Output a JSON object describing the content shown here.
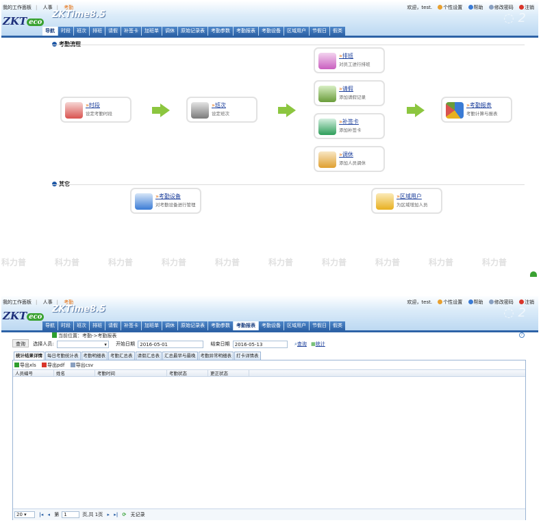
{
  "header": {
    "links": [
      "我的工作面板",
      "人事",
      "考勤"
    ],
    "user": [
      "欢迎，test.",
      "个性设置",
      "帮助",
      "修改密码",
      "注销"
    ],
    "logo_main": "ZKT",
    "logo_eco": "eco",
    "product": "ZKTime8.5"
  },
  "tabs": [
    "导航",
    "时段",
    "班次",
    "排班",
    "请假",
    "补签卡",
    "加班单",
    "调休",
    "原始记录表",
    "考勤参数",
    "考勤报表",
    "考勤设备",
    "区域用户",
    "节假日",
    "假类"
  ],
  "flow": {
    "section1": "考勤流程",
    "section2": "其它",
    "cards": [
      {
        "title": "时段",
        "desc": "设定考勤时段",
        "color": "#d9534f"
      },
      {
        "title": "班次",
        "desc": "设定班次",
        "color": "#7a7a7a"
      },
      {
        "title": "排班",
        "desc": "对员工进行排班",
        "color": "#c95fbf"
      },
      {
        "title": "请假",
        "desc": "添加请假记录",
        "color": "#6a9c3a"
      },
      {
        "title": "补签卡",
        "desc": "添加补签卡",
        "color": "#2e9e5a"
      },
      {
        "title": "调休",
        "desc": "添加人员调休",
        "color": "#e0a030"
      },
      {
        "title": "考勤报表",
        "desc": "考勤计算与报表",
        "color": "#3a7bd5"
      },
      {
        "title": "考勤设备",
        "desc": "对考勤设备进行管理",
        "color": "#3a7bd5"
      },
      {
        "title": "区域用户",
        "desc": "为区域增加人员",
        "color": "#e8b020"
      }
    ]
  },
  "watermark": "科力普",
  "report": {
    "breadcrumb": "当前位置：考勤->考勤报表",
    "query_button": "查询",
    "person_label": "选择人员:",
    "start_label": "开始日期",
    "start_date": "2016-05-01",
    "end_label": "结束日期",
    "end_date": "2016-05-13",
    "action_query": "查询",
    "action_stat": "统计",
    "subtabs": [
      "统计结果详情",
      "每日考勤统计表",
      "考勤明细表",
      "考勤汇总表",
      "请假汇总表",
      "汇总最早与最晚",
      "考勤异常明细表",
      "打卡详情表"
    ],
    "exports": [
      "导出xls",
      "导出pdf",
      "导出csv"
    ],
    "columns": [
      "人员编号",
      "姓名",
      "考勤时间",
      "考勤状态",
      "更正状态"
    ],
    "pager": {
      "page_size": "20",
      "page_prefix": "第",
      "page": "1",
      "page_suffix": "页,共 1页",
      "status": "无记录"
    }
  }
}
